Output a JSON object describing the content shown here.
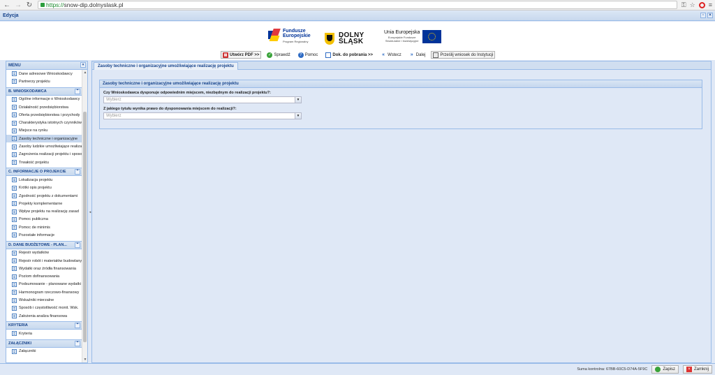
{
  "browser": {
    "url_scheme": "https://",
    "url_host": "snow-dip.dolnyslask.pl"
  },
  "window": {
    "title": "Edycja"
  },
  "logos": {
    "fe_line1": "Fundusze",
    "fe_line2": "Europejskie",
    "fe_sub": "Program Regionalny",
    "ds_line1": "DOLNY",
    "ds_line2": "ŚLĄSK",
    "eu_title": "Unia Europejska",
    "eu_sub1": "Europejskie Fundusze",
    "eu_sub2": "Strukturalne i Inwestycyjne"
  },
  "toolbar": {
    "pdf": "Utwórz PDF >>",
    "check": "Sprawdź",
    "help": "Pomoc",
    "docs": "Dok. do pobrania >>",
    "back": "Wstecz",
    "next": "Dalej",
    "send": "Prześlij wniosek do Instytucji"
  },
  "sidebar": {
    "title": "MENU",
    "top_items": [
      "Dane adresowe Wnioskodawcy",
      "Partnerzy projektu"
    ],
    "sections": [
      {
        "title": "B. WNIOSKODAWCA",
        "items": [
          "Ogólne informacje o Wnioskodawcy",
          "Działalność przedsiębiorstwa",
          "Oferta przedsiębiorstwa i przychody",
          "Charakterystyka istotnych czynników",
          "Miejsce na rynku",
          "Zasoby techniczne i organizacyjne",
          "Zasoby ludzkie umożliwiające realizację",
          "Zagrożenia realizacji projektu i sposoby",
          "Trwałość projektu"
        ]
      },
      {
        "title": "C. INFORMACJE O PROJEKCIE",
        "items": [
          "Lokalizacja projektu",
          "Krótki opis projektu",
          "Zgodność projektu z dokumentami",
          "Projekty komplementarne",
          "Wpływ projektu na realizację zasad",
          "Pomoc publiczna",
          "Pomoc de minimis",
          "Pozostałe informacje"
        ]
      },
      {
        "title": "D. DANE BUDŻETOWE - PLAN...",
        "items": [
          "Rejestr wydatków",
          "Rejestr robót i materiałów budowlanych",
          "Wydatki oraz źródła finansowania",
          "Poziom dofinansowania",
          "Podsumowanie - planowane wydatki",
          "Harmonogram rzeczowo-finansowy",
          "Wskaźniki mierzalne",
          "Sposób i częstotliwość monit. Wsk.",
          "Założenia analiza finansowa"
        ]
      },
      {
        "title": "KRYTERIA",
        "items": [
          "Kryteria"
        ]
      },
      {
        "title": "ZAŁĄCZNIKI",
        "items": [
          "Załączniki"
        ]
      }
    ],
    "selected_item": "Zasoby techniczne i organizacyjne"
  },
  "content": {
    "tab": "Zasoby techniczne i organizacyjne umożliwiające realizację projektu",
    "fieldset_title": "Zasoby techniczne i organizacyjne umożliwiające realizację projektu",
    "q1": "Czy Wnioskodawca dysponuje odpowiednim miejscem, niezbędnym do realizacji projektu?:",
    "q1_placeholder": "Wybierz",
    "q2": "Z jakiego tytułu wynika prawo do dysponowania miejscem do realizacji?:",
    "q2_placeholder": "Wybierz"
  },
  "status": {
    "checksum": "Suma kontrolna: 67BB-60C5-D74A-5F9C",
    "save": "Zapisz",
    "close": "Zamknij"
  }
}
